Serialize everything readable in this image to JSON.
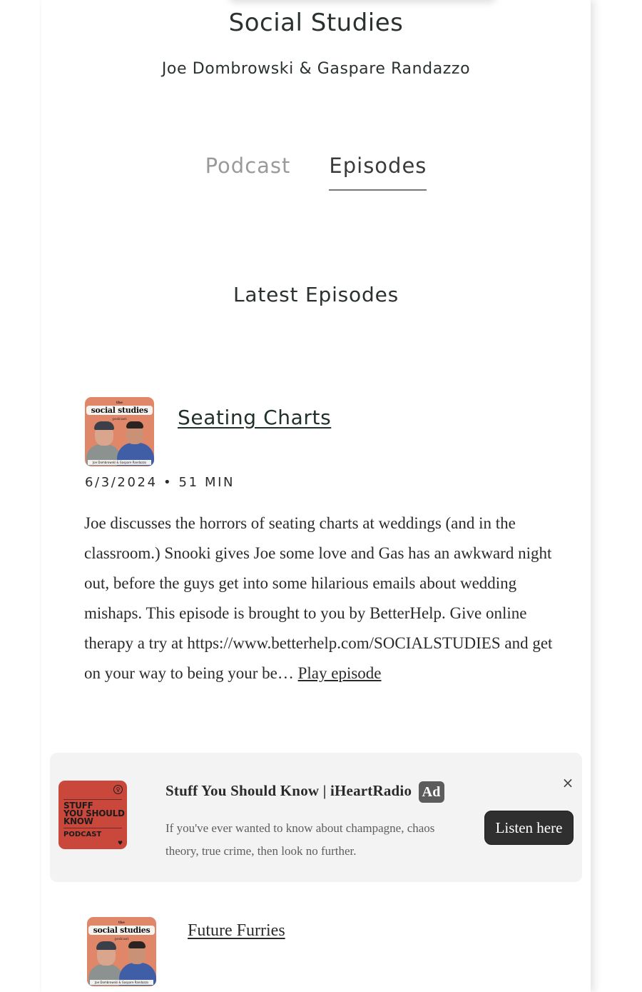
{
  "show": {
    "title": "Social Studies",
    "hosts": "Joe Dombrowski & Gaspare Randazzo"
  },
  "tabs": [
    {
      "label": "Podcast",
      "active": false
    },
    {
      "label": "Episodes",
      "active": true
    }
  ],
  "section_heading": "Latest Episodes",
  "cover_art": {
    "the": "the",
    "brand": "social studies",
    "sub": "podcast",
    "caption": "Joe Dombrowski & Gaspare Randazzo"
  },
  "episodes": [
    {
      "title": "Seating Charts",
      "date": "6/3/2024",
      "separator": "•",
      "duration": "51 MIN",
      "description": "Joe discusses the horrors of seating charts at weddings (and in the classroom.) Snooki gives Joe some love and Gas has an awkward night out, before the guys get into some hilarious emails about wedding mishaps. This episode is brought to you by BetterHelp. Give online therapy a try at https://www.betterhelp.com/SOCIALSTUDIES and get on your way to being your be…",
      "play_label": "Play episode"
    },
    {
      "title": "Future Furries"
    }
  ],
  "ad": {
    "title": "Stuff You Should Know | iHeartRadio",
    "badge": "Ad",
    "text": "If you've ever wanted to know about champagne, chaos theory, true crime, then look no further.",
    "cta_label": "Listen here",
    "close_icon": "×",
    "cover": {
      "line1": "STUFF",
      "line2": "YOU SHOULD",
      "line3": "KNOW",
      "podcast": "PODCAST",
      "logo_glyph": "♀",
      "iheart_glyph": "♥"
    },
    "colors": {
      "cover": "#c9483b",
      "card": "#f3f3f3",
      "button": "#2f2f2f"
    }
  },
  "colors": {
    "podcast_cover": "#e0876a",
    "tab_inactive": "#9a9a9a",
    "tab_active": "#3a3a3a"
  }
}
